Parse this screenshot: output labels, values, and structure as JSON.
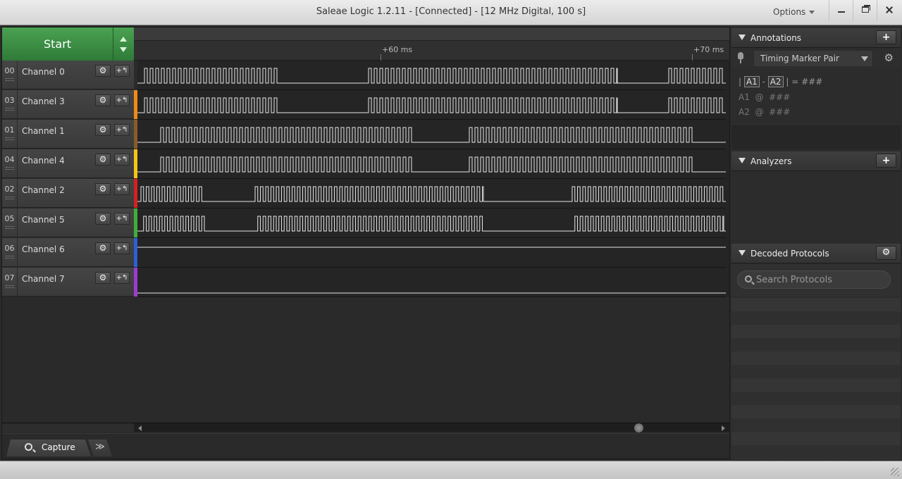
{
  "window": {
    "title": "Saleae Logic 1.2.11 - [Connected] - [12 MHz Digital, 100 s]",
    "options_label": "Options"
  },
  "toolbar": {
    "start_label": "Start"
  },
  "ruler": {
    "ticks": [
      {
        "label": "+60 ms"
      },
      {
        "label": "+70 ms"
      }
    ]
  },
  "channels": [
    {
      "num": "00",
      "name": "Channel 0",
      "color": "#2b2b2b",
      "segments": [
        [
          205,
          396
        ],
        [
          523,
          876
        ],
        [
          949,
          1027
        ]
      ],
      "period": 8.0,
      "start_high": true
    },
    {
      "num": "03",
      "name": "Channel 3",
      "color": "#f08a17",
      "segments": [
        [
          205,
          396
        ],
        [
          523,
          876
        ],
        [
          949,
          1027
        ]
      ],
      "period": 8.0,
      "start_high": true
    },
    {
      "num": "01",
      "name": "Channel 1",
      "color": "#8a5a2b",
      "segments": [
        [
          224,
          588
        ],
        [
          662,
          985
        ]
      ],
      "period": 8.0,
      "start_high": false
    },
    {
      "num": "04",
      "name": "Channel 4",
      "color": "#f5c518",
      "segments": [
        [
          224,
          588
        ],
        [
          662,
          985
        ]
      ],
      "period": 8.0,
      "start_high": false
    },
    {
      "num": "02",
      "name": "Channel 2",
      "color": "#d42020",
      "segments": [
        [
          200,
          290
        ],
        [
          362,
          686
        ],
        [
          812,
          1027
        ]
      ],
      "period": 7.5,
      "start_high": true
    },
    {
      "num": "05",
      "name": "Channel 5",
      "color": "#3fae3a",
      "segments": [
        [
          200,
          290
        ],
        [
          362,
          686
        ],
        [
          812,
          1027
        ]
      ],
      "period": 7.5,
      "start_high": false
    },
    {
      "num": "06",
      "name": "Channel 6",
      "color": "#2e5fd4",
      "segments": [],
      "period": 8,
      "start_high": true
    },
    {
      "num": "07",
      "name": "Channel 7",
      "color": "#9c3bd1",
      "segments": [],
      "period": 8,
      "start_high": false
    }
  ],
  "channel_icons": {
    "settings": "gear-icon",
    "trigger": "trigger-icon"
  },
  "tabs": {
    "capture_label": "Capture",
    "more_label": "≫"
  },
  "annotations": {
    "title": "Annotations",
    "add_label": "+",
    "selector": "Timing Marker Pair",
    "formula": {
      "pipe_l": "|",
      "a1": "A1",
      "dash": "-",
      "a2": "A2",
      "pipe_r": "|",
      "eq": "=",
      "value": "###"
    },
    "marker_a1": {
      "label": "A1",
      "at": "@",
      "value": "###"
    },
    "marker_a2": {
      "label": "A2",
      "at": "@",
      "value": "###"
    }
  },
  "analyzers": {
    "title": "Analyzers",
    "add_label": "+"
  },
  "decoded": {
    "title": "Decoded Protocols",
    "search_placeholder": "Search Protocols"
  }
}
